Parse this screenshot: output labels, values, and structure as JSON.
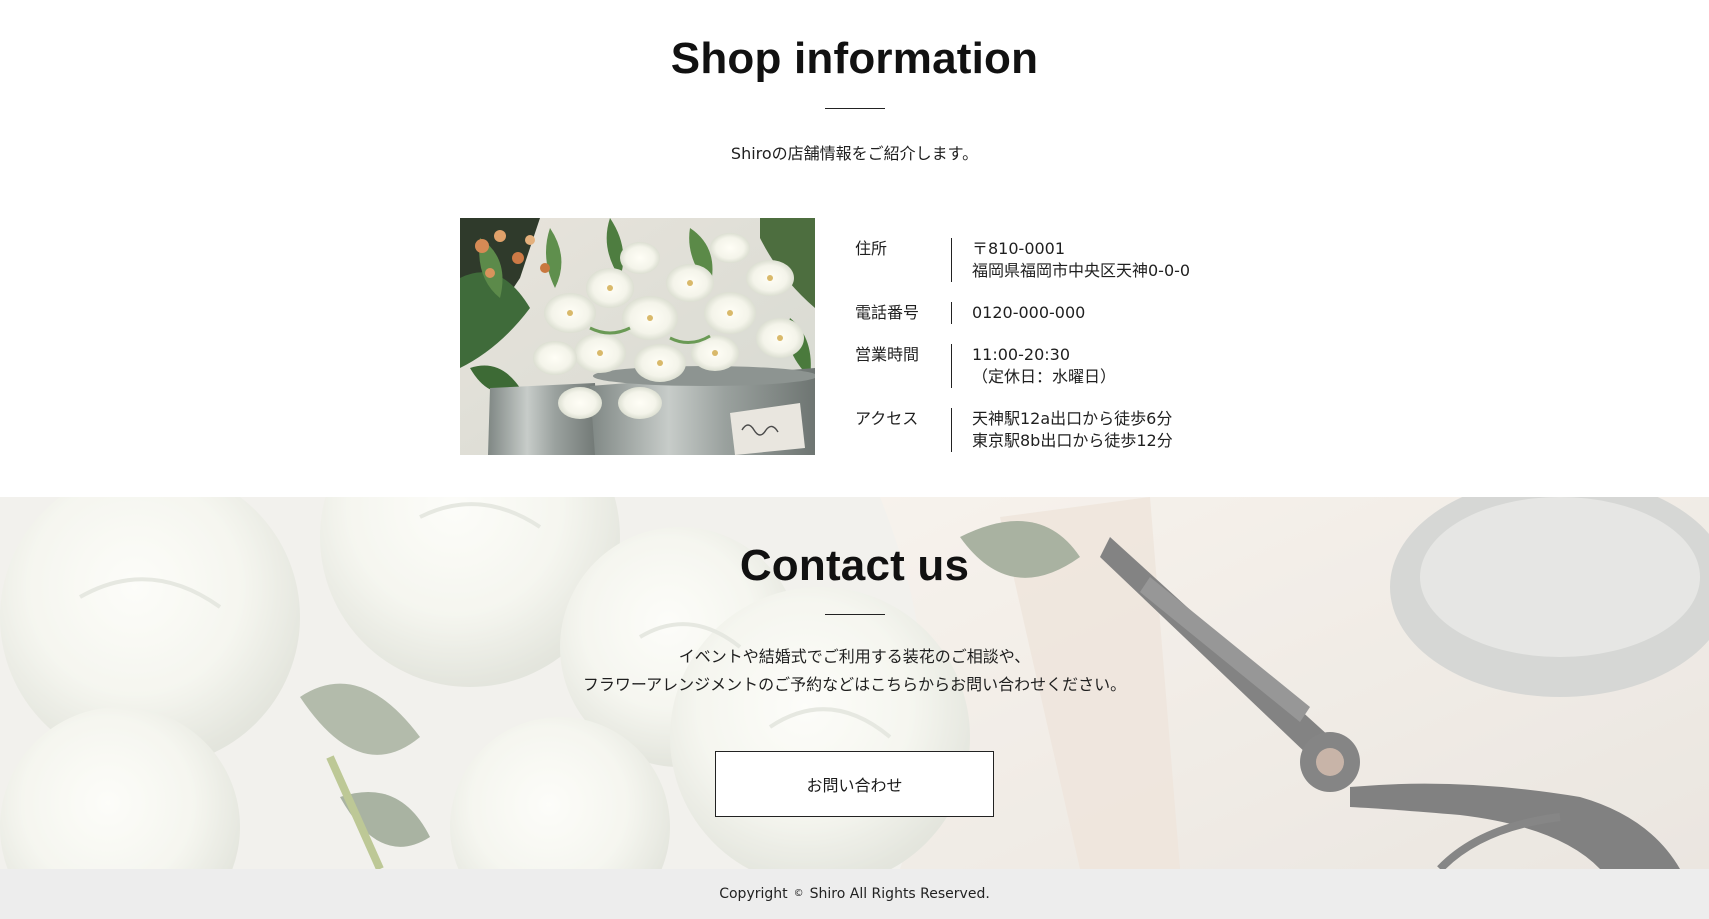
{
  "shop": {
    "title": "Shop information",
    "lead": "Shiroの店舗情報をご紹介します。",
    "rows": [
      {
        "label": "住所",
        "lines": [
          "〒810-0001",
          "福岡県福岡市中央区天神0-0-0"
        ]
      },
      {
        "label": "電話番号",
        "lines": [
          "0120-000-000"
        ]
      },
      {
        "label": "営業時間",
        "lines": [
          "11:00-20:30",
          "（定休日：水曜日）"
        ]
      },
      {
        "label": "アクセス",
        "lines": [
          "天神駅12a出口から徒歩6分",
          "東京駅8b出口から徒歩12分"
        ]
      }
    ]
  },
  "contact": {
    "title": "Contact us",
    "lead_lines": [
      "イベントや結婚式でご利用する装花のご相談や、",
      "フラワーアレンジメントのご予約などはこちらからお問い合わせください。"
    ],
    "button_label": "お問い合わせ"
  },
  "footer": {
    "copyright_prefix": "Copyright",
    "copyright_symbol": "©",
    "copyright_text": "Shiro All Rights Reserved."
  },
  "colors": {
    "text": "#1a1a1a",
    "footer_bg": "#ededed",
    "button_border": "#222222"
  },
  "icons": {
    "shop_photo": "white-flowers-in-tin-buckets-photo",
    "contact_background": "white-roses-and-scissors-photo"
  }
}
